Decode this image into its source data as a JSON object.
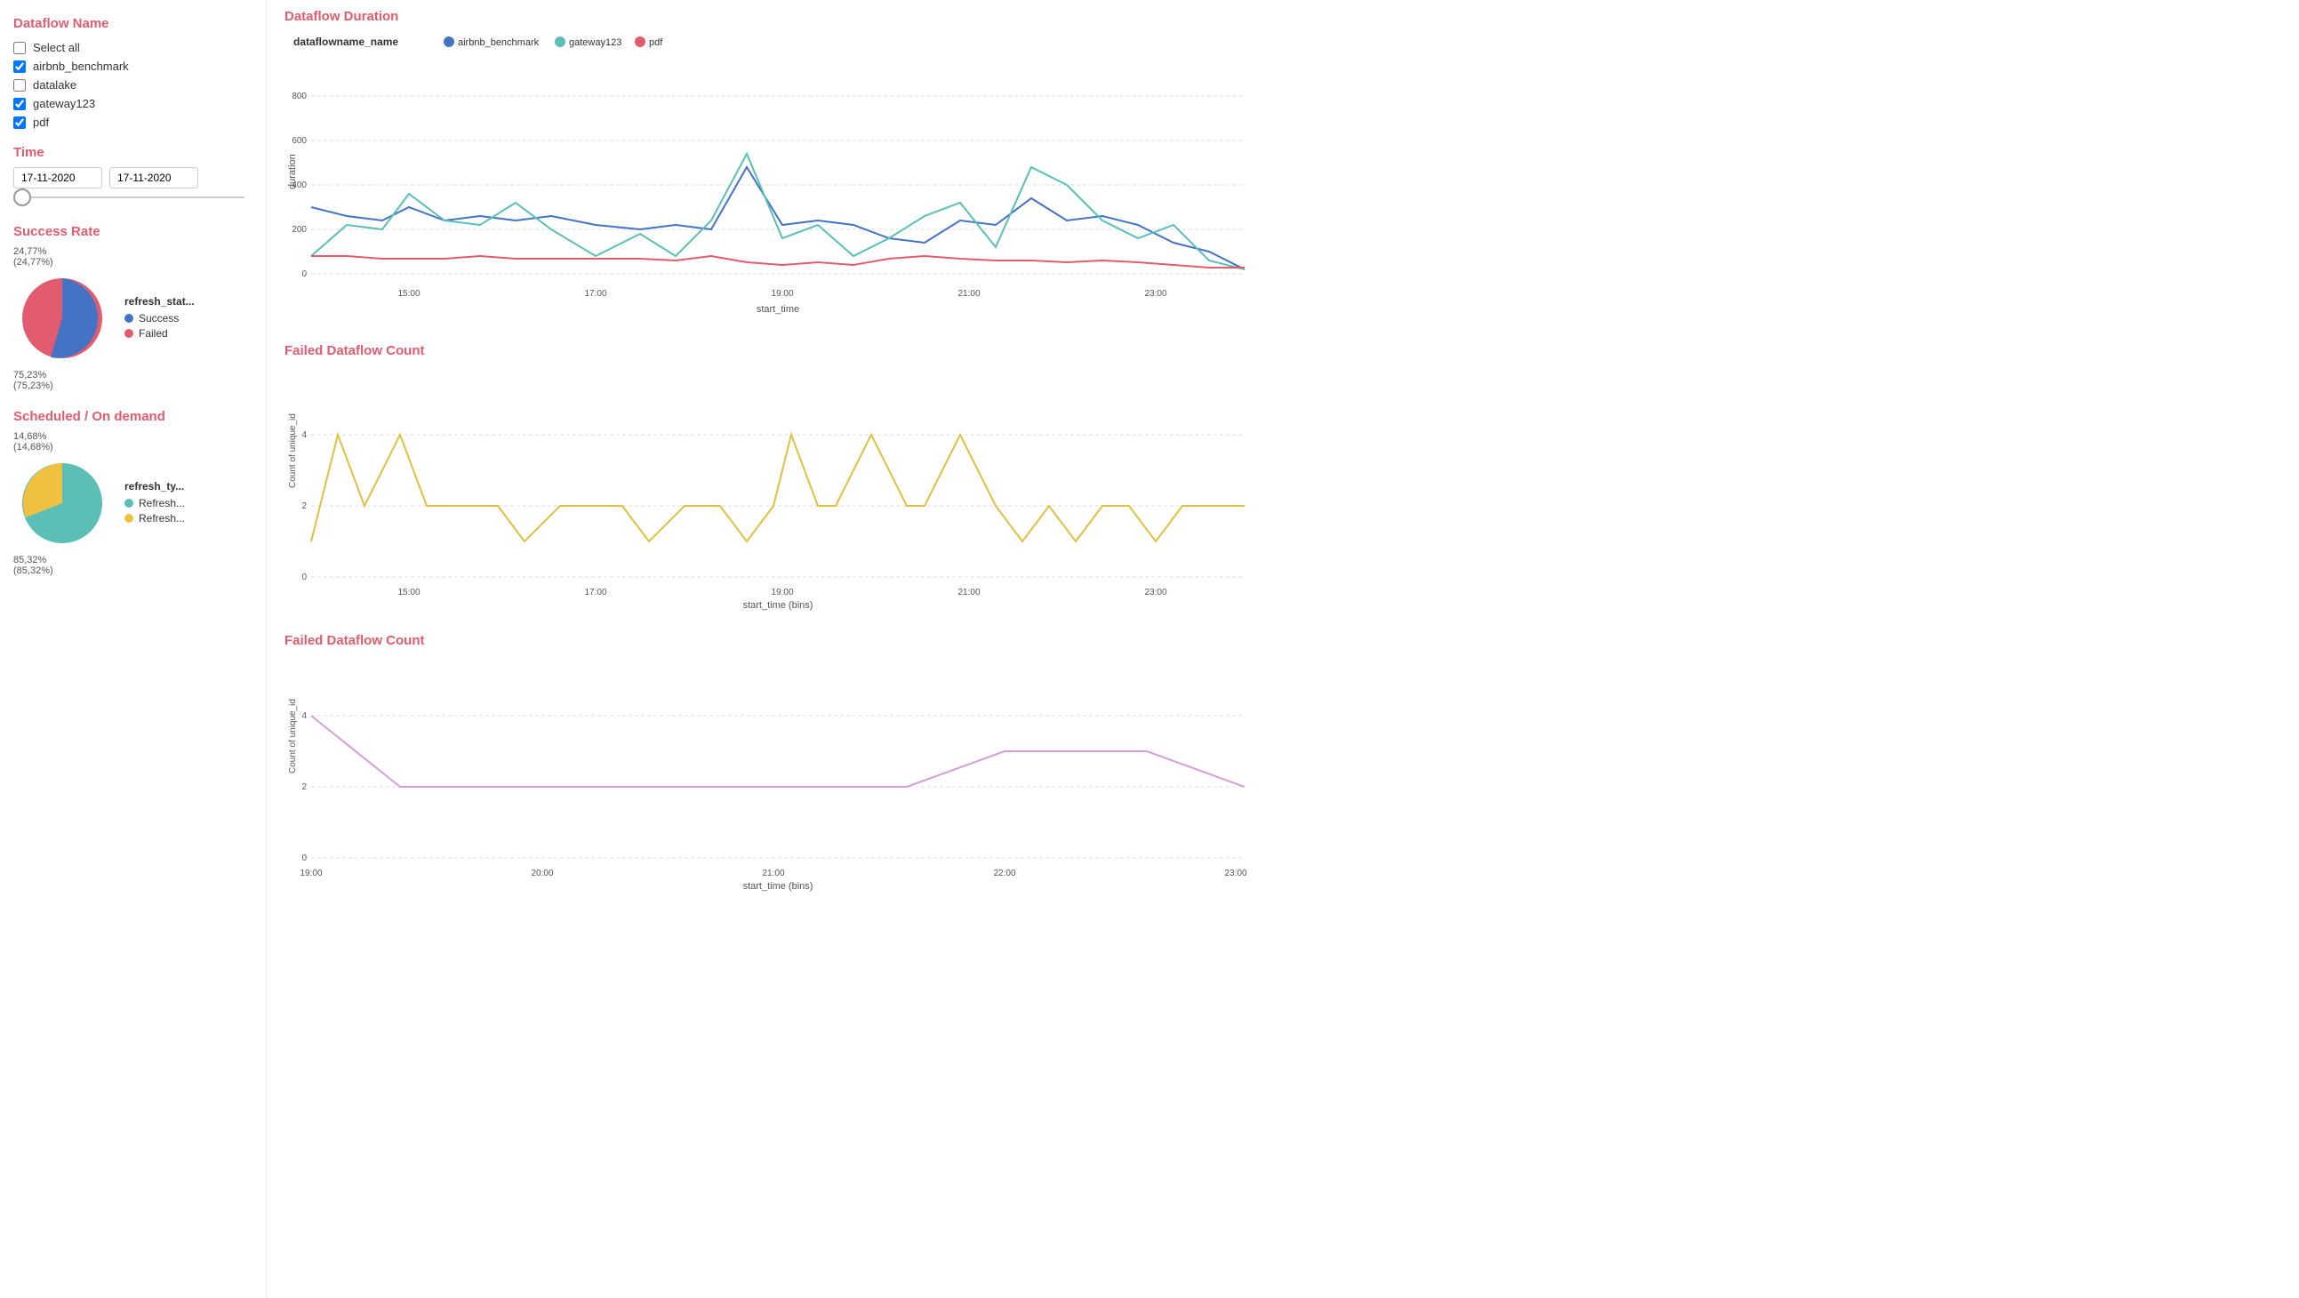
{
  "sidebar": {
    "dataflow_title": "Dataflow Name",
    "select_all_label": "Select all",
    "filters": [
      {
        "id": "airbnb",
        "label": "airbnb_benchmark",
        "checked": true
      },
      {
        "id": "datalake",
        "label": "datalake",
        "checked": false
      },
      {
        "id": "gateway",
        "label": "gateway123",
        "checked": true
      },
      {
        "id": "pdf",
        "label": "pdf",
        "checked": true
      }
    ],
    "time_title": "Time",
    "time_from": "17-11-2020",
    "time_to": "17-11-2020"
  },
  "charts": {
    "duration": {
      "title": "Dataflow Duration",
      "legend_label": "dataflowname_name",
      "series": [
        {
          "name": "airbnb_benchmark",
          "color": "#4472c4"
        },
        {
          "name": "gateway123",
          "color": "#5bbfb5"
        },
        {
          "name": "pdf",
          "color": "#e05c6e"
        }
      ],
      "x_label": "start_time",
      "y_label": "duration",
      "y_ticks": [
        "0",
        "200",
        "400",
        "600",
        "800"
      ],
      "x_ticks": [
        "15:00",
        "17:00",
        "19:00",
        "21:00",
        "23:00"
      ]
    },
    "failed_count_1": {
      "title": "Failed Dataflow Count",
      "color": "#e0c040",
      "x_label": "start_time (bins)",
      "y_label": "Count of unique_id",
      "y_ticks": [
        "0",
        "2",
        "4"
      ],
      "x_ticks": [
        "15:00",
        "17:00",
        "19:00",
        "21:00",
        "23:00"
      ]
    },
    "failed_count_2": {
      "title": "Failed Dataflow Count",
      "color": "#d4a0d4",
      "x_label": "start_time (bins)",
      "y_label": "Count of unique_id",
      "y_ticks": [
        "0",
        "2",
        "4"
      ],
      "x_ticks": [
        "19:00",
        "20:00",
        "21:00",
        "22:00",
        "23:00"
      ]
    }
  },
  "success_rate": {
    "title": "Success Rate",
    "legend_title": "refresh_stat...",
    "segments": [
      {
        "label": "Success",
        "color": "#4472c4",
        "percent": "75,23%",
        "percent2": "(75,23%)"
      },
      {
        "label": "Failed",
        "color": "#e05c6e",
        "percent": "24,77%",
        "percent2": "(24,77%)"
      }
    ]
  },
  "scheduled": {
    "title": "Scheduled / On demand",
    "legend_title": "refresh_ty...",
    "segments": [
      {
        "label": "Refresh...",
        "color": "#5bbfb5",
        "percent": "85,32%",
        "percent2": "(85,32%)"
      },
      {
        "label": "Refresh...",
        "color": "#f0c040",
        "percent": "14,68%",
        "percent2": "(14,68%)"
      }
    ]
  }
}
